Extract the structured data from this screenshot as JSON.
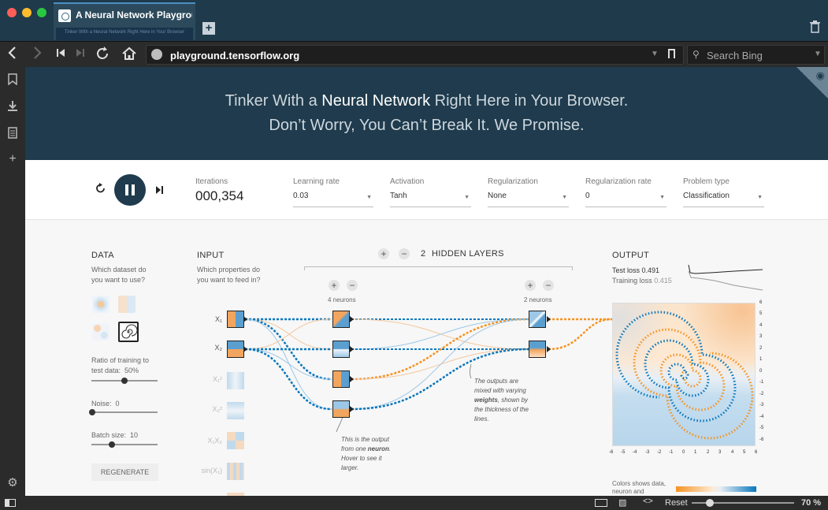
{
  "browser": {
    "tab_title": "A Neural Network Playground",
    "tab_thumbnail_text": "Tinker With a Neural Network Right Here in Your Browser",
    "url": "playground.tensorflow.org",
    "search_placeholder": "Search Bing",
    "status": {
      "reset_label": "Reset",
      "zoom": "70 %"
    }
  },
  "header": {
    "line1_pre": "Tinker With a ",
    "line1_bold": "Neural Network",
    "line1_post": " Right Here in Your Browser.",
    "line2": "Don’t Worry, You Can’t Break It. We Promise."
  },
  "controls": {
    "iterations_label": "Iterations",
    "iterations_value": "000,354",
    "learning_rate": {
      "label": "Learning rate",
      "value": "0.03"
    },
    "activation": {
      "label": "Activation",
      "value": "Tanh"
    },
    "regularization": {
      "label": "Regularization",
      "value": "None"
    },
    "regularization_rate": {
      "label": "Regularization rate",
      "value": "0"
    },
    "problem_type": {
      "label": "Problem type",
      "value": "Classification"
    }
  },
  "data_panel": {
    "title": "DATA",
    "question": "Which dataset do you want to use?",
    "ratio_label": "Ratio of training to test data:",
    "ratio_value": "50%",
    "ratio_fraction": 0.5,
    "noise_label": "Noise:",
    "noise_value": "0",
    "noise_fraction": 0.0,
    "batch_label": "Batch size:",
    "batch_value": "10",
    "batch_fraction": 0.3,
    "regenerate": "REGENERATE"
  },
  "input_panel": {
    "title": "INPUT",
    "question": "Which properties do you want to feed in?",
    "features": [
      "X₁",
      "X₂",
      "X₁²",
      "X₂²",
      "X₁X₂",
      "sin(X₁)"
    ]
  },
  "hidden": {
    "count": "2",
    "label": "HIDDEN LAYERS",
    "layer1_neurons": "4 neurons",
    "layer2_neurons": "2 neurons",
    "plus": "+",
    "minus": "−"
  },
  "notes": {
    "neuron_note_pre": "This is the output from one ",
    "neuron_note_bold": "neuron",
    "neuron_note_post": ". Hover to see it larger.",
    "weights_note_pre": "The outputs are mixed with varying ",
    "weights_note_bold": "weights",
    "weights_note_post": ", shown by the thickness of the lines."
  },
  "output_panel": {
    "title": "OUTPUT",
    "test_loss_label": "Test loss",
    "test_loss": "0.491",
    "training_loss_label": "Training loss",
    "training_loss": "0.415",
    "colors_note": "Colors shows data, neuron and",
    "y_ticks": [
      "6",
      "5",
      "4",
      "3",
      "2",
      "1",
      "0",
      "-1",
      "-2",
      "-3",
      "-4",
      "-5",
      "-6"
    ],
    "x_ticks": [
      "-6",
      "-5",
      "-4",
      "-3",
      "-2",
      "-1",
      "0",
      "1",
      "2",
      "3",
      "4",
      "5",
      "6"
    ]
  },
  "colors": {
    "orange": "#f59322",
    "blue": "#0877bd",
    "header": "#1f3b4d"
  }
}
